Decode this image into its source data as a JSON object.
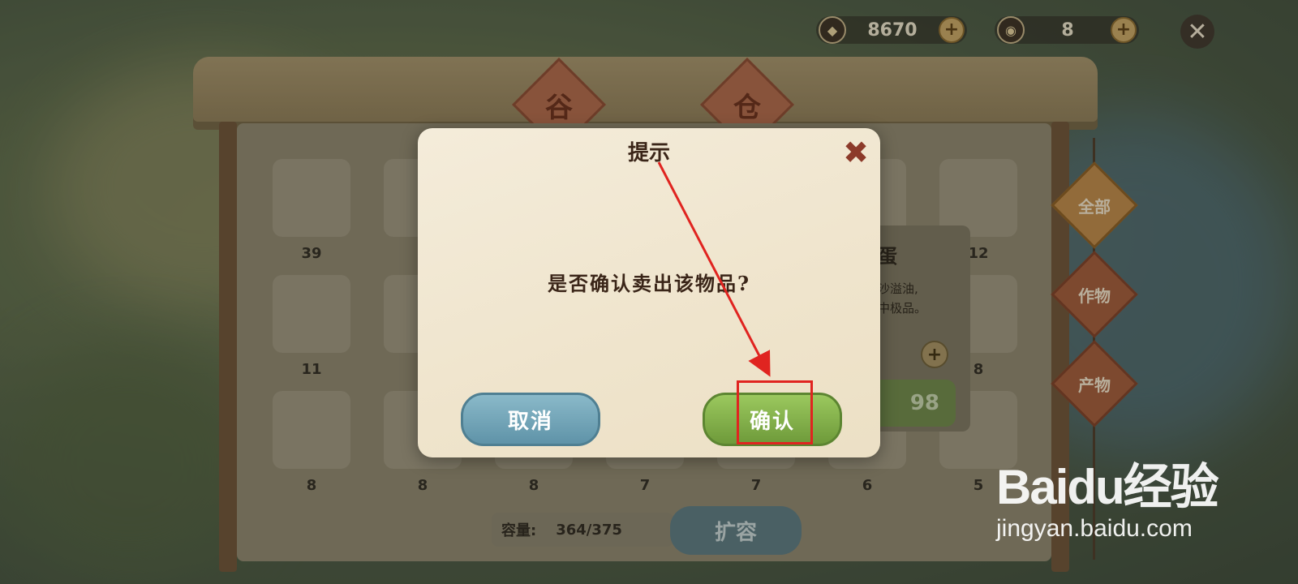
{
  "currency": [
    {
      "icon": "coin-icon",
      "value": "8670"
    },
    {
      "icon": "copper-coin-icon",
      "value": "8"
    }
  ],
  "granary": {
    "sign_chars": [
      "谷",
      "仓"
    ],
    "item_counts": [
      [
        "39",
        "",
        "",
        "",
        "",
        "",
        "12"
      ],
      [
        "11",
        "",
        "",
        "",
        "",
        "",
        "8"
      ],
      [
        "8",
        "8",
        "8",
        "7",
        "7",
        "6",
        "5"
      ]
    ],
    "capacity_label": "容量:",
    "capacity_value": "364/375",
    "expand_label": "扩容"
  },
  "side_tabs": [
    {
      "label": "全部",
      "active": true
    },
    {
      "label": "作物",
      "active": false
    },
    {
      "label": "产物",
      "active": false
    }
  ],
  "info_panel": {
    "title": "蛋",
    "desc_line1": "沙溢油,",
    "desc_line2": "中极品。",
    "price": "98"
  },
  "dialog": {
    "title": "提示",
    "message": "是否确认卖出该物品?",
    "cancel_label": "取消",
    "confirm_label": "确认"
  },
  "watermark": {
    "logo": "Baidu经验",
    "sub": "jingyan.baidu.com"
  },
  "colors": {
    "confirm": "#6e9a3a",
    "cancel": "#5f93a8",
    "highlight": "#e02420"
  }
}
